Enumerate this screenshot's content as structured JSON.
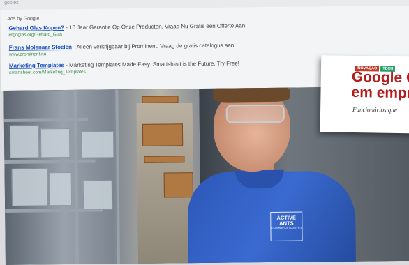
{
  "top_strip": {
    "crumb": "gooles"
  },
  "ads": {
    "label": "Ads by Google",
    "items": [
      {
        "title": "Gehard Glas Kopen?",
        "text": " - 10 Jaar Garantie Op Onze Producten. Vraag Nu Gratis een Offerte Aan!",
        "url": "ergoglas.org/Gehard_Glas"
      },
      {
        "title": "Frans Molenaar Stoelen",
        "text": " - Alleen verkrijgbaar bij Prominent. Vraag de gratis catalogus aan!",
        "url": "www.prominent.nu"
      },
      {
        "title": "Marketing Templates",
        "text": " - Marketing Templates Made Easy. Smartsheet is the Future. Try Free!",
        "url": "smartsheet.com/Marketing_Templates"
      }
    ]
  },
  "photo": {
    "logo_line1": "ACTIVE",
    "logo_line2": "ANTS",
    "logo_line3": "E-COMMERCE LOGISTICS"
  },
  "card": {
    "tag1": "INOVAÇÃO",
    "tag2": "TECH",
    "tag1_color": "#c0392b",
    "tag2_color": "#27a06a",
    "headline_line1": "Google G",
    "headline_line2": "em empr",
    "subline": "Funcionários que"
  }
}
